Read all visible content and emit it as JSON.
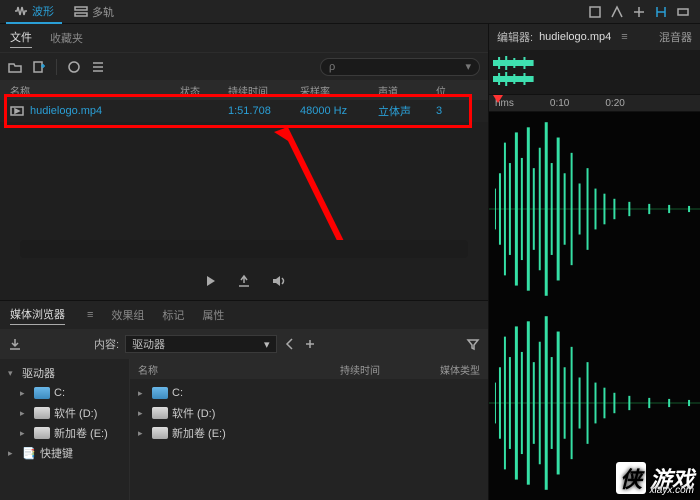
{
  "top_tabs": {
    "waveform": "波形",
    "multitrack": "多轨"
  },
  "file_panel": {
    "tabs": {
      "files": "文件",
      "favorites": "收藏夹"
    },
    "search_placeholder": "ρ",
    "headers": {
      "name": "名称",
      "state": "状态",
      "duration": "持续时间",
      "samplerate": "采样率",
      "channels": "声道",
      "extra": "位"
    },
    "row": {
      "name": "hudielogo.mp4",
      "duration": "1:51.708",
      "samplerate": "48000 Hz",
      "channels": "立体声",
      "extra": "3"
    }
  },
  "media_panel": {
    "tabs": {
      "browser": "媒体浏览器",
      "effects": "效果组",
      "markers": "标记",
      "properties": "属性"
    },
    "content_label": "内容:",
    "content_value": "驱动器",
    "col_name": "名称",
    "col_dur": "持续时间",
    "col_type": "媒体类型",
    "tree": {
      "drives_root": "驱动器",
      "c": "C:",
      "d": "软件 (D:)",
      "e": "新加卷 (E:)",
      "shortcuts": "快捷键"
    }
  },
  "editor": {
    "label": "编辑器:",
    "filename": "hudielogo.mp4",
    "mixer": "混音器",
    "time_hms": "hms",
    "t1": "0:10",
    "t2": "0:20"
  },
  "watermark": {
    "brand": "侠",
    "text": "游戏",
    "url": "xiayx.com"
  }
}
